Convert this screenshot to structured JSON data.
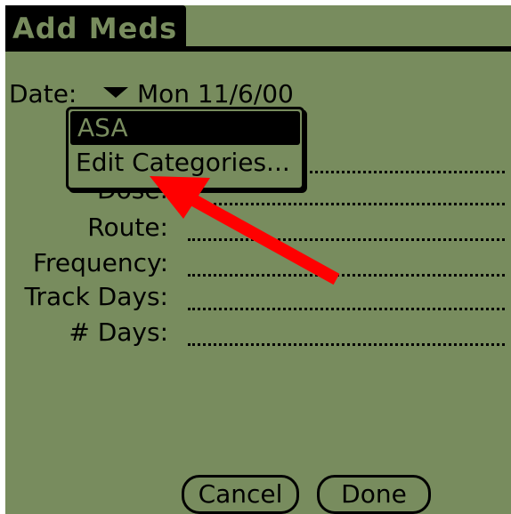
{
  "form": {
    "title": "Add Meds",
    "date_label": "Date:",
    "date_value": "Mon 11/6/00",
    "fields": [
      {
        "label": "Dose:"
      },
      {
        "label": "Route:"
      },
      {
        "label": "Frequency:"
      },
      {
        "label": "Track Days:"
      },
      {
        "label": "# Days:"
      }
    ]
  },
  "popup": {
    "items": [
      {
        "label": "ASA",
        "selected": true
      },
      {
        "label": "Edit Categories...",
        "selected": false
      }
    ]
  },
  "buttons": {
    "cancel": "Cancel",
    "done": "Done"
  },
  "colors": {
    "screen_bg": "#788c5e",
    "ink": "#000000",
    "annotation_arrow": "#ff0000"
  }
}
